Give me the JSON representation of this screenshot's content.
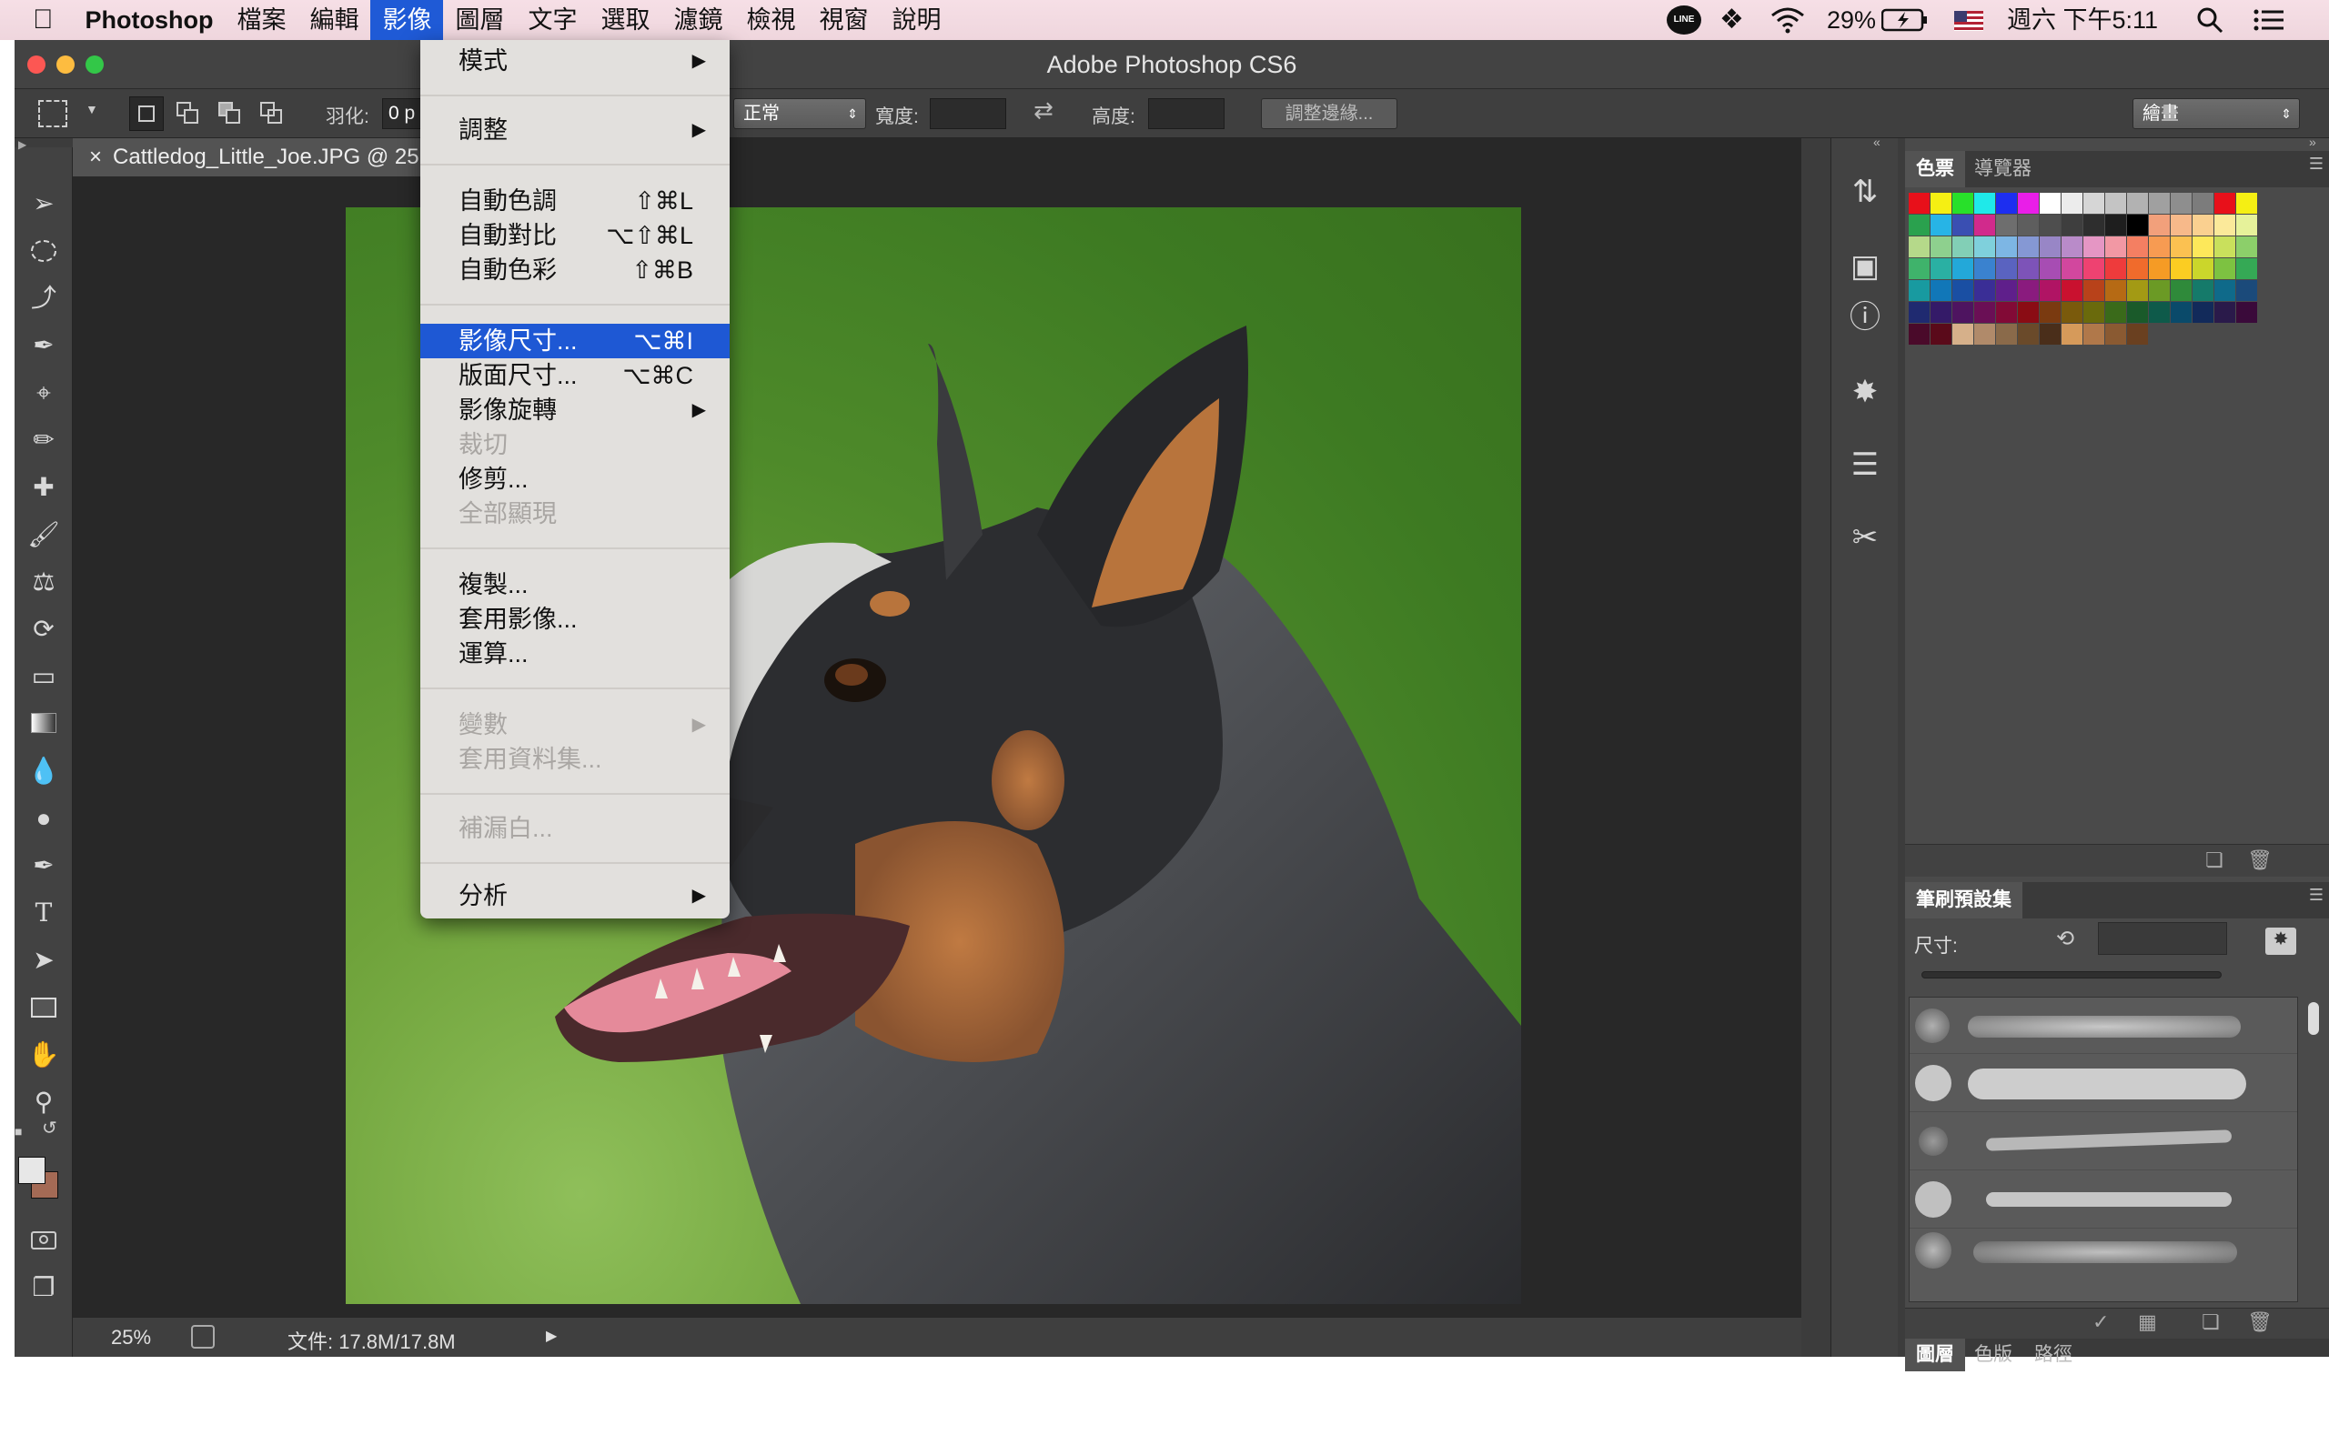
{
  "menubar": {
    "app": "Photoshop",
    "items": [
      "檔案",
      "編輯",
      "影像",
      "圖層",
      "文字",
      "選取",
      "濾鏡",
      "檢視",
      "視窗",
      "說明"
    ],
    "active_index": 2,
    "battery": "29%",
    "clock": "週六 下午5:11",
    "line_label": "LINE"
  },
  "window": {
    "title": "Adobe Photoshop CS6"
  },
  "options": {
    "feather_label": "羽化:",
    "feather_value": "0 p",
    "style_value": "正常",
    "width_label": "寬度:",
    "height_label": "高度:",
    "refine_button": "調整邊緣...",
    "workspace": "繪畫"
  },
  "document": {
    "tab_title": "Cattledog_Little_Joe.JPG @ 25"
  },
  "status": {
    "zoom": "25%",
    "doc_info": "文件: 17.8M/17.8M"
  },
  "image_menu": {
    "mode": "模式",
    "adjustments": "調整",
    "auto_tone": {
      "label": "自動色調",
      "shortcut": "⇧⌘L"
    },
    "auto_contrast": {
      "label": "自動對比",
      "shortcut": "⌥⇧⌘L"
    },
    "auto_color": {
      "label": "自動色彩",
      "shortcut": "⇧⌘B"
    },
    "image_size": {
      "label": "影像尺寸...",
      "shortcut": "⌥⌘I"
    },
    "canvas_size": {
      "label": "版面尺寸...",
      "shortcut": "⌥⌘C"
    },
    "image_rotation": "影像旋轉",
    "crop": "裁切",
    "trim": "修剪...",
    "reveal_all": "全部顯現",
    "duplicate": "複製...",
    "apply_image": "套用影像...",
    "calculations": "運算...",
    "variables": "變數",
    "apply_data_set": "套用資料集...",
    "trap": "補漏白...",
    "analysis": "分析"
  },
  "panels": {
    "swatches_tab": "色票",
    "navigator_tab": "導覽器",
    "brush_presets_tab": "筆刷預設集",
    "size_label": "尺寸:",
    "bottom_tabs": [
      "圖層",
      "色版",
      "路徑"
    ]
  },
  "swatch_colors": [
    "#e8101a",
    "#f5ef13",
    "#28e02a",
    "#1fe9e9",
    "#1d2ef0",
    "#e91ee8",
    "#ffffff",
    "#ececec",
    "#d6d6d6",
    "#c4c4c4",
    "#b2b2b2",
    "#a0a0a0",
    "#8e8e8e",
    "#7c7c7c",
    "#e8101a",
    "#f5ef13",
    "#2aa14e",
    "#27b4e6",
    "#3a4fb2",
    "#d12a8c",
    "#6e6e6e",
    "#5e5e5e",
    "#4e4e4e",
    "#3e3e3e",
    "#2e2e2e",
    "#1e1e1e",
    "#000000",
    "#f2a07b",
    "#f7b98a",
    "#fad090",
    "#fbe99a",
    "#e6f29a",
    "#b5d98a",
    "#8ed08e",
    "#82cfb6",
    "#7fd0dc",
    "#7db6e4",
    "#8598d4",
    "#9886c6",
    "#b98bc9",
    "#e596c4",
    "#f298a4",
    "#f47f62",
    "#f79b52",
    "#fbc151",
    "#fde85a",
    "#c9e05c",
    "#8ccf6a",
    "#3fb36b",
    "#2ab0a3",
    "#23a8d9",
    "#3a82cf",
    "#5a63c0",
    "#7d53b8",
    "#a74db3",
    "#d2479e",
    "#ee4271",
    "#ee3b3c",
    "#f06b2c",
    "#f59b25",
    "#fbcd22",
    "#cbd62b",
    "#7dc241",
    "#35a955",
    "#189aa0",
    "#1177b8",
    "#1a4fa3",
    "#3a2e96",
    "#5f1f8b",
    "#8a1b7e",
    "#b01464",
    "#c9112f",
    "#b8421a",
    "#b66a14",
    "#a39a14",
    "#6b9a25",
    "#2f8a3a",
    "#157a6a",
    "#0f6a8a",
    "#1b4a7a",
    "#1f2a70",
    "#341a68",
    "#4e1460",
    "#6a0f55",
    "#820a36",
    "#8a0c14",
    "#7a3a10",
    "#7a5a0c",
    "#6a6a0c",
    "#3a6a1a",
    "#1a5a2a",
    "#0e5a4a",
    "#0a4a6a",
    "#122a5a",
    "#2a1a4a",
    "#3a0a3a",
    "#4a0a2a",
    "#5a0a1a",
    "#d6b08a",
    "#b08a6a",
    "#8a6a4a",
    "#6a4a2a",
    "#4a2e1a",
    "#d69a5a",
    "#b0784a",
    "#8a5a32",
    "#6a4020"
  ]
}
